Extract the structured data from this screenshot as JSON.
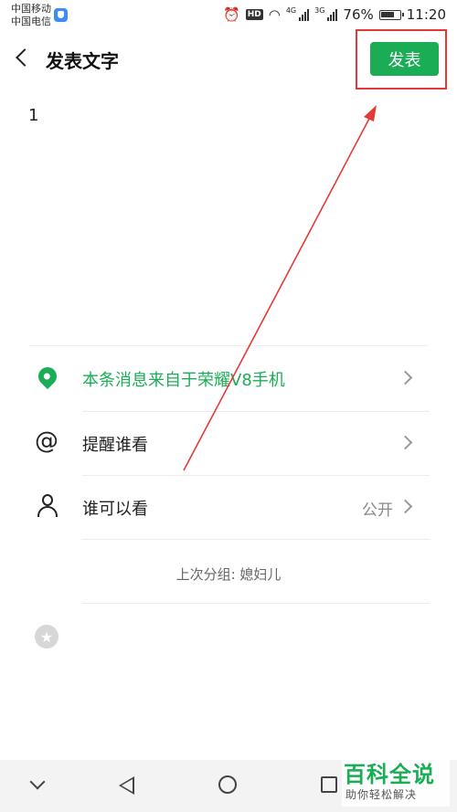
{
  "status_bar": {
    "carrier_1": "中国移动",
    "carrier_2": "中国电信",
    "hd": "HD",
    "net_1": "4G",
    "net_2": "3G",
    "battery": "76%",
    "time": "11:20"
  },
  "header": {
    "title": "发表文字",
    "publish_label": "发表"
  },
  "post": {
    "text": "1"
  },
  "options": {
    "location_label": "本条消息来自于荣耀V8手机",
    "remind_label": "提醒谁看",
    "visibility_label": "谁可以看",
    "visibility_value": "公开"
  },
  "last_group": "上次分组: 媳妇儿",
  "watermark": {
    "main": "百科全说",
    "sub": "助你轻松解决"
  },
  "colors": {
    "accent": "#1aad56",
    "annotation": "#e53935"
  },
  "icons": [
    "back-arrow-icon",
    "location-pin-icon",
    "at-icon",
    "person-icon",
    "star-icon",
    "chevron-right-icon",
    "nav-down-icon",
    "nav-back-icon",
    "nav-home-icon",
    "nav-recent-icon"
  ]
}
